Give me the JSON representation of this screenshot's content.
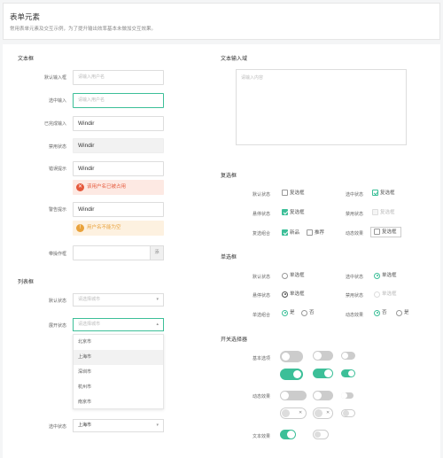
{
  "header": {
    "title": "表单元素",
    "desc": "常用表单元素及交互示例，为了提升输出效率基本未做加交互效果。"
  },
  "sections": {
    "text_box": "文本框",
    "textarea": "文本输入域",
    "list_box": "列表框",
    "checkbox": "复选框",
    "radio": "单选框",
    "switch": "开关选择器"
  },
  "text_box": {
    "default_label": "默认输入框",
    "default_placeholder": "请输入用户名",
    "focus_label": "选中输入",
    "focus_placeholder": "请输入用户名",
    "filled_label": "已完成输入",
    "filled_value": "Windir",
    "disabled_label": "禁用状态",
    "disabled_value": "Windir",
    "error_label": "错误提示",
    "error_value": "Windir",
    "error_msg": "该用户名已被占用",
    "warn_label": "警告提示",
    "warn_value": "Windir",
    "warn_msg": "用户名不能为空",
    "addon_label": "带操作框",
    "addon_btn": "添"
  },
  "textarea": {
    "placeholder": "请输入内容"
  },
  "list_box": {
    "default_label": "默认状态",
    "default_placeholder": "请选择城市",
    "open_label": "展开状态",
    "open_placeholder": "请选择城市",
    "options": [
      "北京市",
      "上海市",
      "深圳市",
      "杭州市",
      "南京市"
    ],
    "selected_label": "选中状态",
    "selected_value": "上海市"
  },
  "checkbox": {
    "default_label": "默认状态",
    "default_text": "复选框",
    "checked_label": "选中状态",
    "checked_text": "复选框",
    "hover_label": "悬停状态",
    "hover_text": "复选框",
    "disabled_label": "禁用状态",
    "disabled_text": "复选框",
    "group_label": "复选组合",
    "group_opt1": "新品",
    "group_opt2": "推荐",
    "effect_label": "动态效果",
    "effect_text": "复选框"
  },
  "radio": {
    "default_label": "默认状态",
    "default_text": "单选框",
    "checked_label": "选中状态",
    "checked_text": "单选框",
    "hover_label": "悬停状态",
    "hover_text": "单选框",
    "disabled_label": "禁用状态",
    "disabled_text": "单选框",
    "group_label": "单选组合",
    "group_yes": "是",
    "group_no": "否",
    "effect_label": "动态效果",
    "effect_no": "否",
    "effect_yes": "是"
  },
  "switch": {
    "basic_label": "基本选项",
    "effect_label": "动态效果",
    "text_label": "文本效果",
    "x_mark": "✕"
  },
  "colors": {
    "accent": "#3cbf98",
    "error": "#e5583b",
    "warning": "#e9a23b"
  }
}
